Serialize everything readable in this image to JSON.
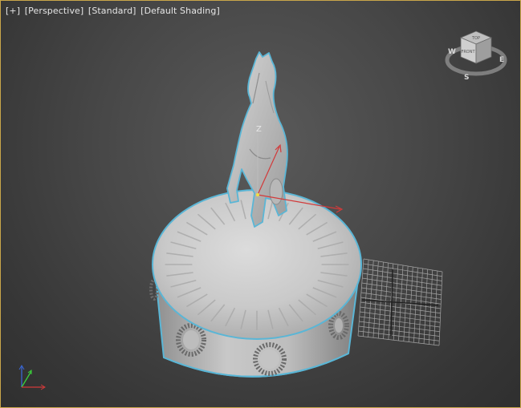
{
  "viewport": {
    "labels": {
      "plus": "[+]",
      "view": "[Perspective]",
      "style": "[Standard]",
      "shading": "[Default Shading]"
    },
    "gizmo": {
      "z_label": "Z"
    }
  },
  "viewcube": {
    "top_label": "TOP",
    "front_label": "FRONT",
    "compass": {
      "w": "W",
      "s": "S",
      "e": "E"
    }
  },
  "colors": {
    "viewport_border": "#c9a64a",
    "selection_outline": "#5ab6d6",
    "gizmo_x": "#d23a3a",
    "gizmo_y": "#3ad23a",
    "gizmo_z": "#3a66d2",
    "grid": "#b5b5b5"
  },
  "icons": [
    "viewcube-icon",
    "axis-tripod-icon",
    "transform-gizmo-icon"
  ]
}
